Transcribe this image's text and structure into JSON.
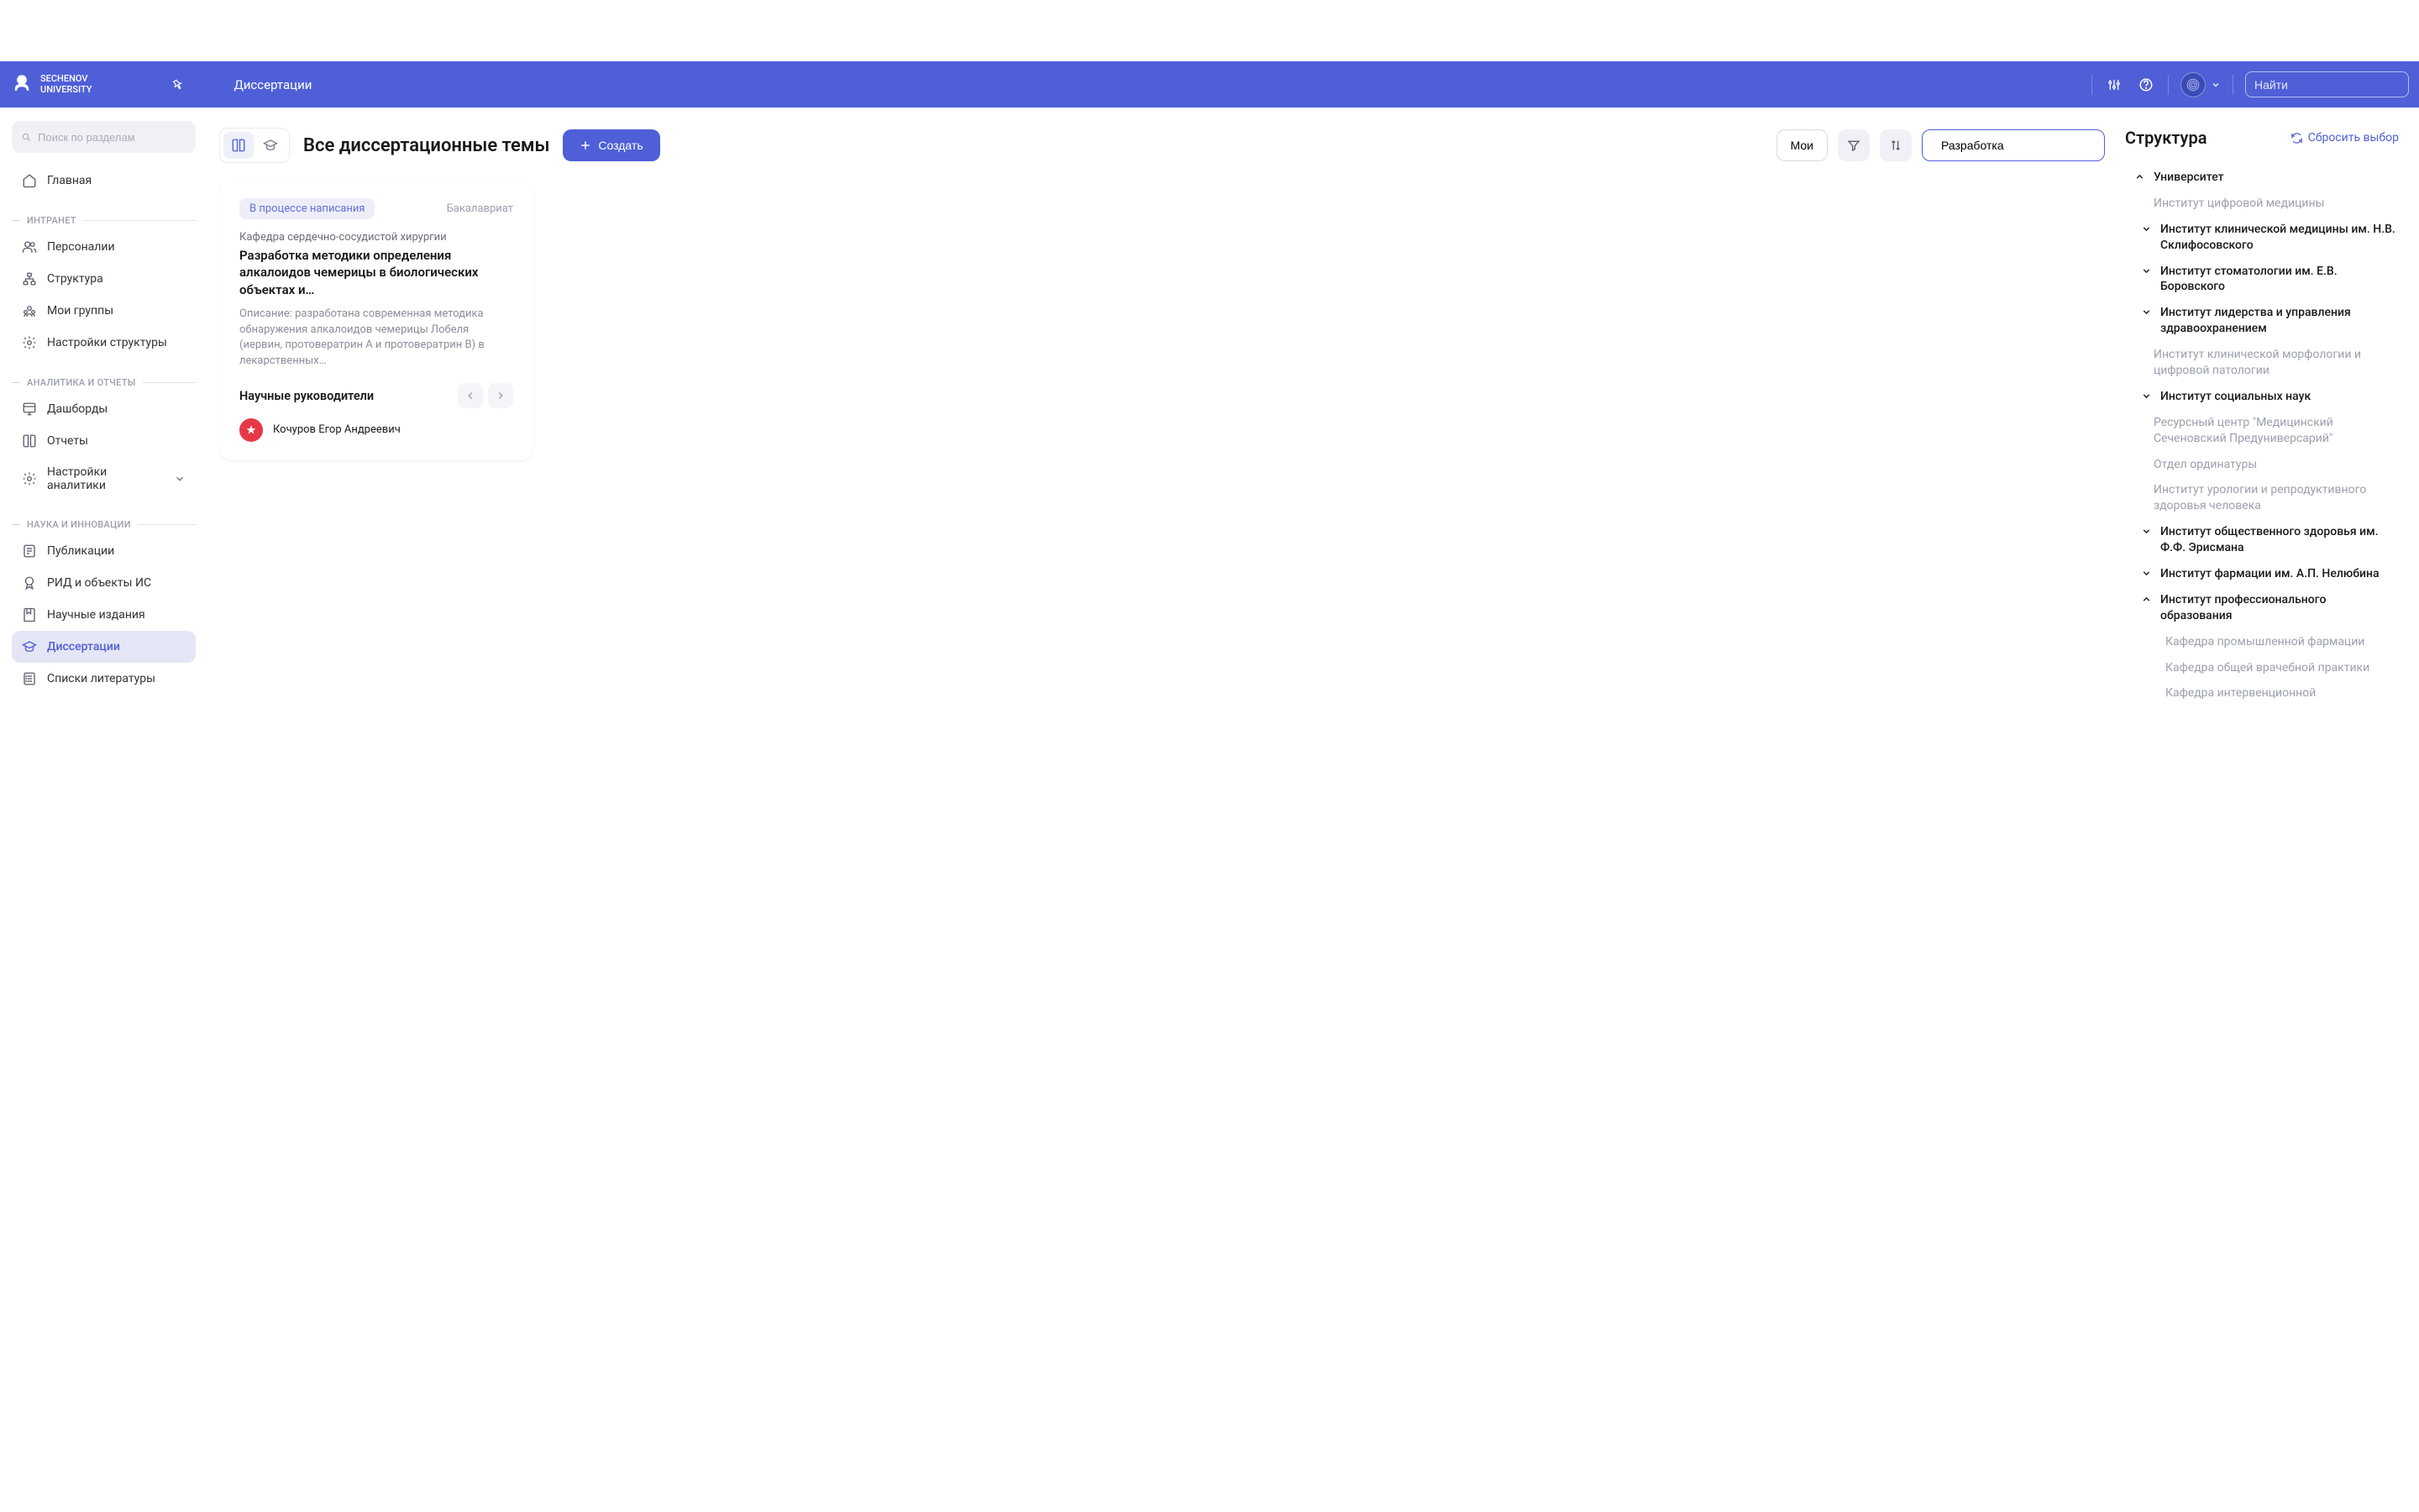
{
  "header": {
    "logo_top": "SECHENOV",
    "logo_bottom": "UNIVERSITY",
    "title": "Диссертации",
    "search_placeholder": "Найти"
  },
  "sidebar": {
    "search_placeholder": "Поиск по разделам",
    "home": "Главная",
    "sections": {
      "intranet": {
        "label": "ИНТРАНЕТ",
        "items": [
          "Персоналии",
          "Структура",
          "Мои группы",
          "Настройки структуры"
        ]
      },
      "analytics": {
        "label": "АНАЛИТИКА И ОТЧЕТЫ",
        "items": [
          "Дашборды",
          "Отчеты",
          "Настройки аналитики"
        ]
      },
      "science": {
        "label": "НАУКА И ИННОВАЦИИ",
        "items": [
          "Публикации",
          "РИД и объекты ИС",
          "Научные издания",
          "Диссертации",
          "Списки литературы"
        ]
      }
    }
  },
  "main": {
    "page_title": "Все диссертационные темы",
    "create_button": "Создать",
    "mine_button": "Мои",
    "search_value": "Разработка"
  },
  "card": {
    "status": "В процессе написания",
    "level": "Бакалавриат",
    "department": "Кафедра сердечно-сосудистой хирургии",
    "title": "Разработка методики определения алкалоидов чемерицы в биологических объектах и…",
    "description": "Описание: разработана современная методика обнаружения алкалоидов чемерицы Лобеля (иервин, протовератрин A и протовератрин B) в лекарственных…",
    "supervisors_label": "Научные руководители",
    "supervisor_name": "Кочуров Егор Андреевич"
  },
  "panel": {
    "title": "Структура",
    "reset": "Сбросить выбор",
    "university": "Университет",
    "items": [
      {
        "text": "Институт цифровой медицины",
        "level": "2",
        "expandable": false
      },
      {
        "text": "Институт клинической медицины им. Н.В. Склифосовского",
        "level": "2bold",
        "expandable": true
      },
      {
        "text": "Институт стоматологии им. Е.В. Боровского",
        "level": "2bold",
        "expandable": true
      },
      {
        "text": "Институт лидерства и управления здравоохранением",
        "level": "2bold",
        "expandable": true
      },
      {
        "text": "Институт клинической морфологии и цифровой патологии",
        "level": "2",
        "expandable": false
      },
      {
        "text": "Институт социальных наук",
        "level": "2bold",
        "expandable": true
      },
      {
        "text": "Ресурсный центр \"Медицинский Сеченовский Предуниверсарий\"",
        "level": "2",
        "expandable": false
      },
      {
        "text": "Отдел ординатуры",
        "level": "2",
        "expandable": false
      },
      {
        "text": "Институт урологии и репродуктивного здоровья человека",
        "level": "2",
        "expandable": false
      },
      {
        "text": "Институт общественного здоровья им. Ф.Ф. Эрисмана",
        "level": "2bold",
        "expandable": true
      },
      {
        "text": "Институт фармации им. А.П. Нелюбина",
        "level": "2bold",
        "expandable": true
      },
      {
        "text": "Институт профессионального образования",
        "level": "2bold",
        "expandable": true,
        "expanded": true
      },
      {
        "text": "Кафедра промышленной фармации",
        "level": "3",
        "expandable": false
      },
      {
        "text": "Кафедра общей врачебной практики",
        "level": "3",
        "expandable": false
      },
      {
        "text": "Кафедра интервенционной",
        "level": "3",
        "expandable": false
      }
    ]
  }
}
